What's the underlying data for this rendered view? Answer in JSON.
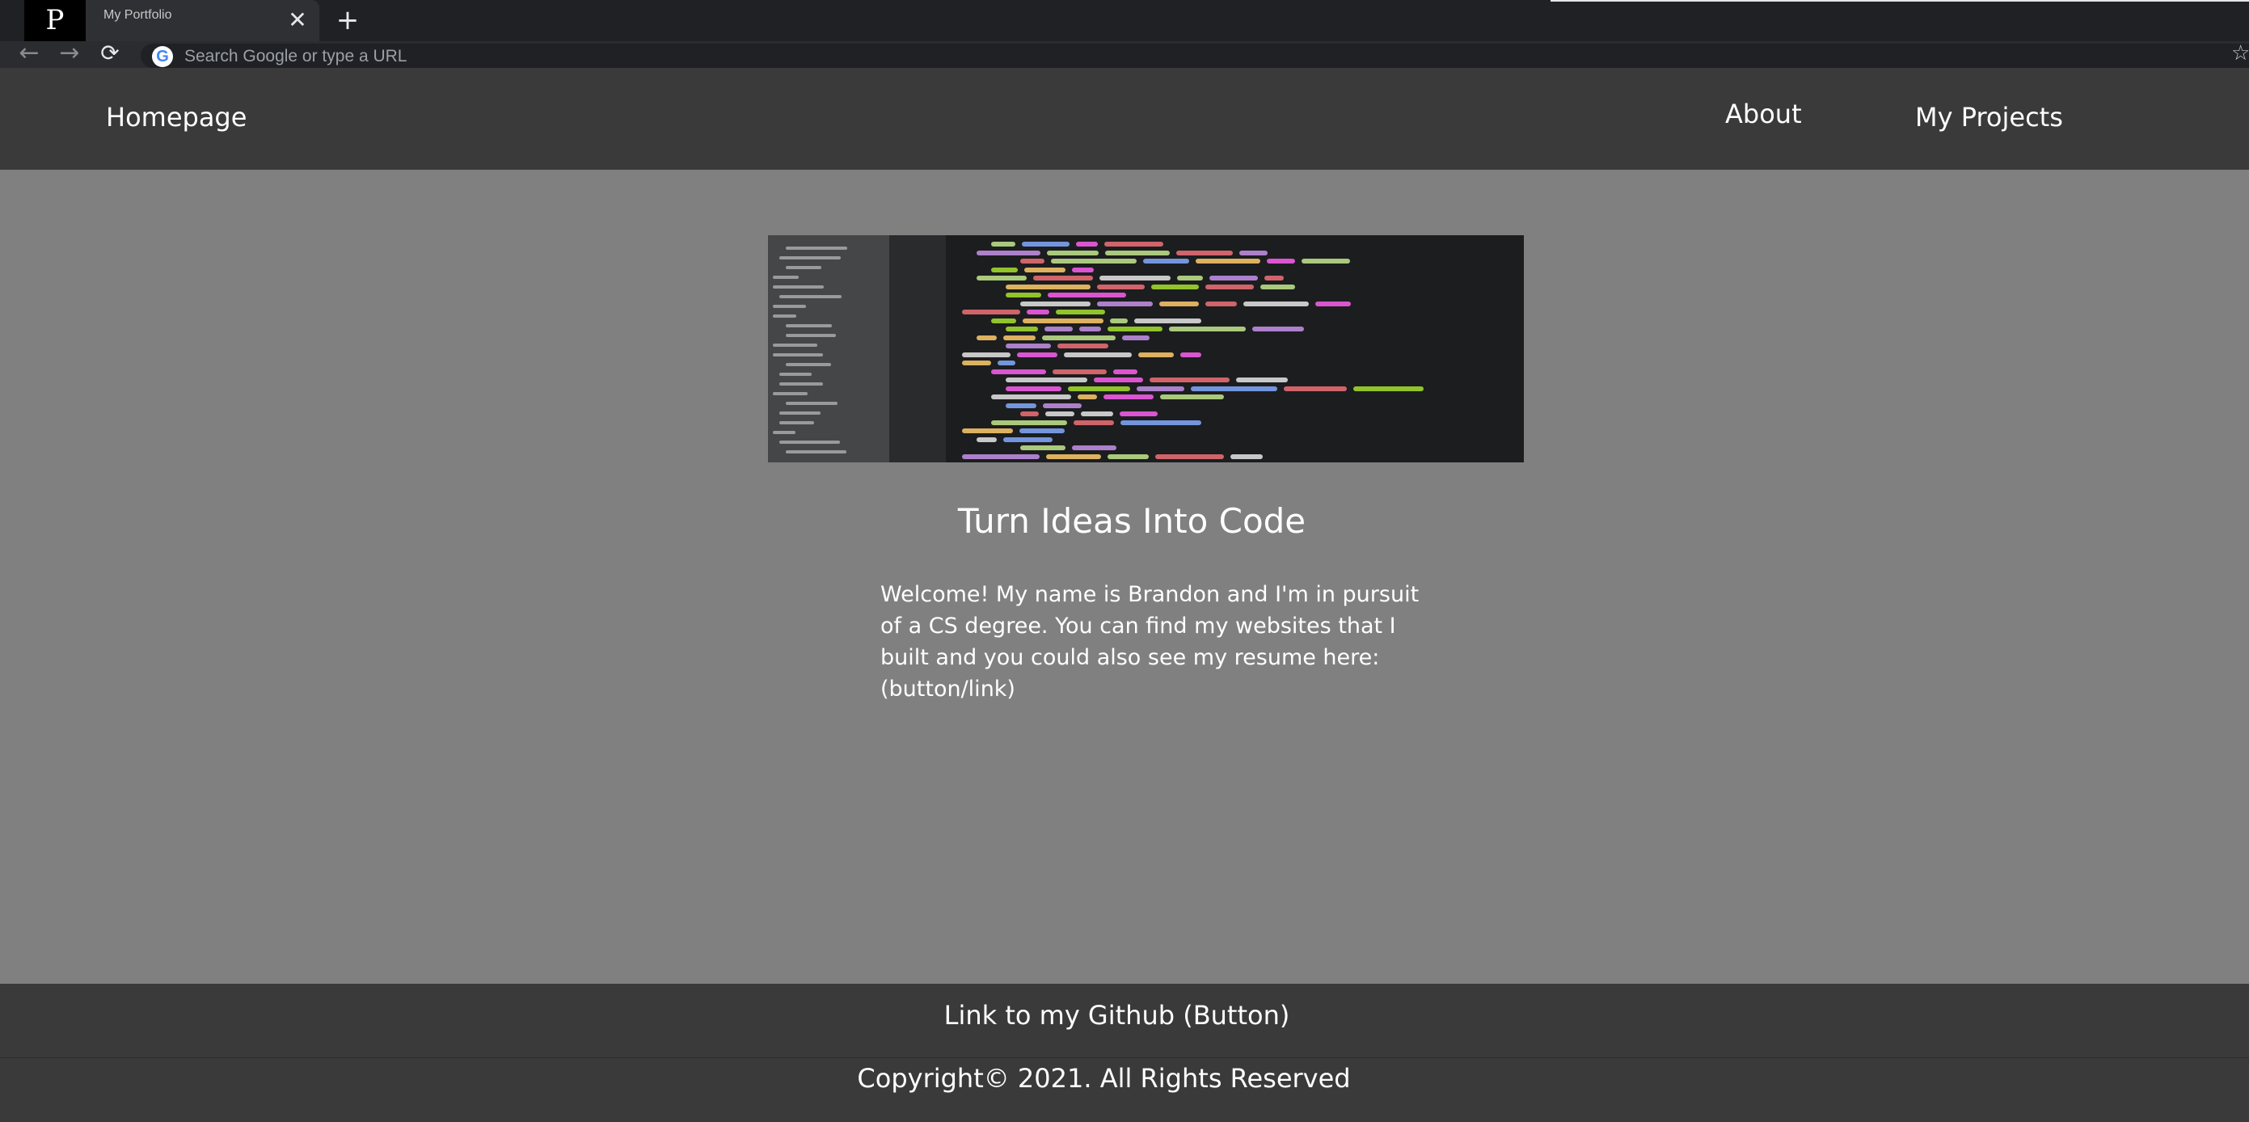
{
  "browser": {
    "tab": {
      "favicon_letter": "P",
      "title": "My Portfolio",
      "close_glyph": "✕"
    },
    "new_tab_glyph": "+",
    "toolbar": {
      "back_icon": "arrow-left-icon",
      "forward_icon": "arrow-right-icon",
      "reload_icon": "reload-icon",
      "omnibox_placeholder": "Search Google or type a URL",
      "search_engine_icon": "google-icon",
      "bookmark_icon": "star-icon"
    }
  },
  "nav": {
    "home_label": "Homepage",
    "about_label": "About",
    "projects_label": "My Projects"
  },
  "main": {
    "hero_image": "code-editor-screenshot",
    "headline": "Turn Ideas Into Code",
    "intro": "Welcome! My name is Brandon and I'm in pursuit of a CS degree. You can find my websites that I built and you could also see my resume here: (button/link)"
  },
  "footer": {
    "github_label": "Link to my Github (Button)",
    "copyright": "Copyright© 2021. All Rights Reserved"
  },
  "colors": {
    "page_background": "#808080",
    "header_background": "#3a3a3a",
    "footer_background": "#3a3a3a",
    "text": "#ffffff",
    "browser_tabstrip": "#202124"
  }
}
